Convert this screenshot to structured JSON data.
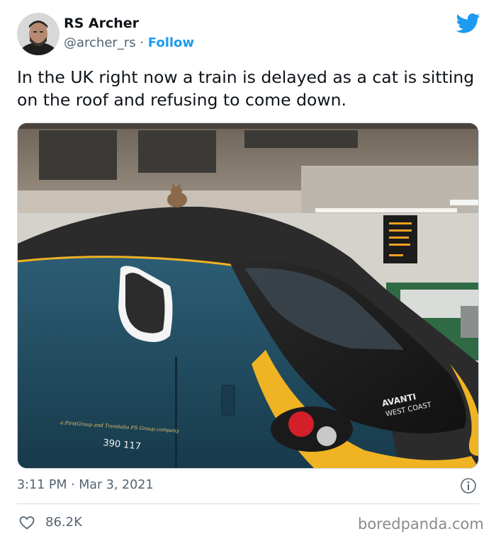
{
  "author": {
    "display_name": "RS Archer",
    "handle": "@archer_rs",
    "separator": " · ",
    "follow_label": "Follow"
  },
  "tweet": {
    "text": "In the UK right now a train is delayed as a cat is sitting on the roof and refusing to come down.",
    "timestamp": "3:11 PM · Mar 3, 2021",
    "likes": "86.2K"
  },
  "photo": {
    "train_brand": "AVANTI",
    "train_brand_sub": "WEST COAST",
    "train_tagline": "a FirstGroup and Trenitalia FS Group company",
    "train_number": "390 117"
  },
  "icons": {
    "logo": "twitter-bird-icon",
    "info": "info-icon",
    "like": "heart-icon"
  },
  "colors": {
    "accent": "#1d9bf0",
    "text": "#0f1419",
    "secondary": "#536471",
    "train_body": "#1f4a5e",
    "train_stripe": "#f0b323"
  },
  "watermark": "boredpanda.com"
}
